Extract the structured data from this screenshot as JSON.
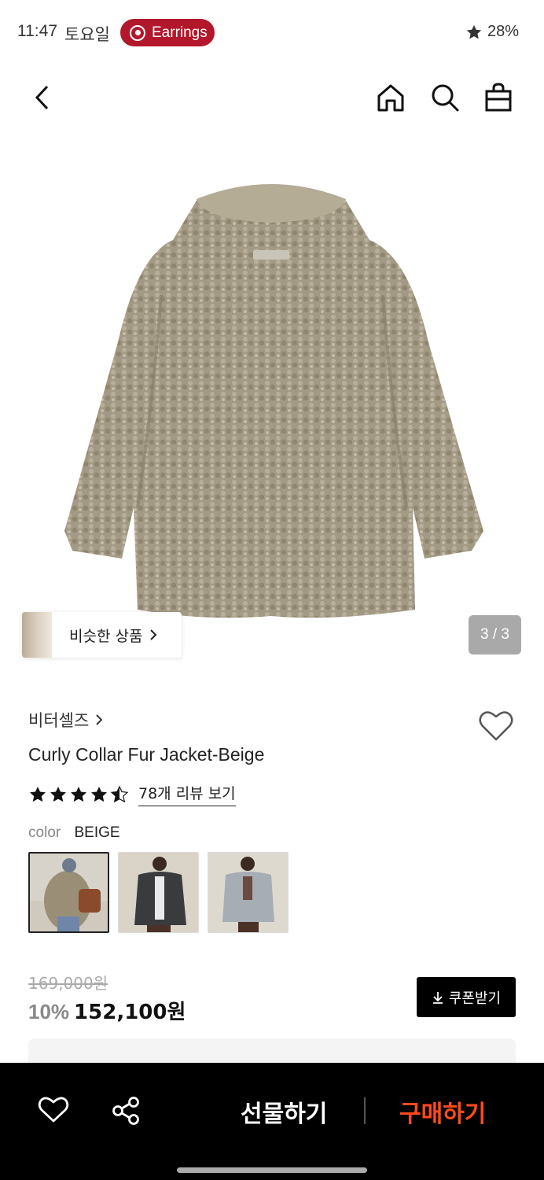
{
  "status": {
    "time": "11:47",
    "day": "토요일",
    "notification": "Earrings",
    "battery": "28%"
  },
  "nav": {
    "back_icon": "back-arrow-icon",
    "home_icon": "home-icon",
    "search_icon": "search-icon",
    "bag_icon": "shopping-bag-icon"
  },
  "gallery": {
    "similar_label": "비슷한 상품",
    "page_counter": "3 / 3"
  },
  "product": {
    "brand": "비터셀즈",
    "title": "Curly Collar Fur Jacket-Beige",
    "rating": 4.5,
    "review_link": "78개 리뷰 보기",
    "color_label": "color",
    "color_value": "BEIGE",
    "swatches": [
      "beige",
      "charcoal",
      "light-grey"
    ]
  },
  "price": {
    "original": "169,000원",
    "discount": "10%",
    "final": "152,100원",
    "coupon_label": "쿠폰받기"
  },
  "bottom_bar": {
    "gift_label": "선물하기",
    "buy_label": "구매하기"
  },
  "colors": {
    "accent": "#ff4a1c",
    "notif": "#b3172b",
    "fur": "#a39a85"
  }
}
